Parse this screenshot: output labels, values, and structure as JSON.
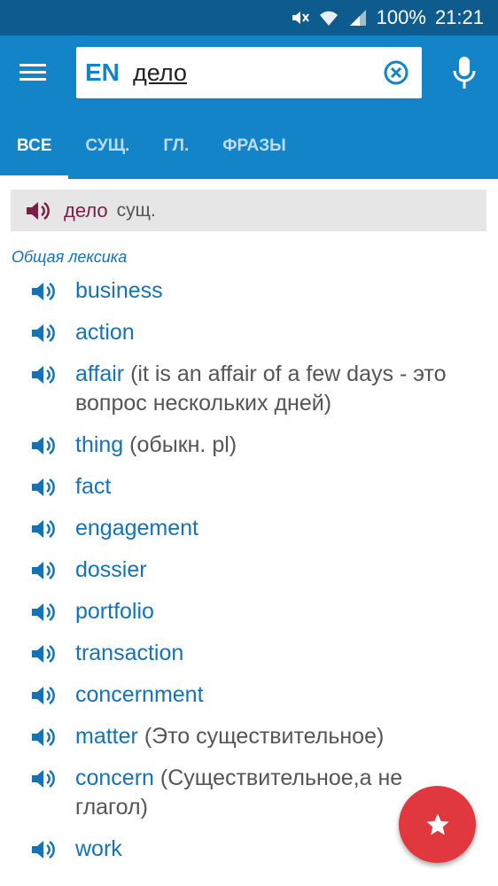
{
  "status_bar": {
    "battery": "100%",
    "time": "21:21"
  },
  "search": {
    "language": "EN",
    "query": "дело"
  },
  "tabs": [
    {
      "label": "ВСЕ",
      "active": true
    },
    {
      "label": "СУЩ.",
      "active": false
    },
    {
      "label": "ГЛ.",
      "active": false
    },
    {
      "label": "ФРАЗЫ",
      "active": false
    }
  ],
  "headword": {
    "word": "дело",
    "pos": "сущ."
  },
  "section": "Общая лексика",
  "entries": [
    {
      "word": "business",
      "note": ""
    },
    {
      "word": "action",
      "note": ""
    },
    {
      "word": "affair",
      "note": "(it is an affair of a few days - это вопрос нескольких дней)"
    },
    {
      "word": "thing",
      "note": "(обыкн. pl)"
    },
    {
      "word": "fact",
      "note": ""
    },
    {
      "word": "engagement",
      "note": ""
    },
    {
      "word": "dossier",
      "note": ""
    },
    {
      "word": "portfolio",
      "note": ""
    },
    {
      "word": "transaction",
      "note": ""
    },
    {
      "word": "concernment",
      "note": ""
    },
    {
      "word": "matter",
      "note": "(Это существительное)"
    },
    {
      "word": "concern",
      "note": "(Существительное,а не глагол)"
    },
    {
      "word": "work",
      "note": ""
    }
  ],
  "colors": {
    "app_bar": "#1384c7",
    "status_bar": "#0e5c8d",
    "link": "#1573b5",
    "headword": "#7a1e48",
    "fab": "#e0383e"
  },
  "icons": [
    "mute-icon",
    "wifi-icon",
    "signal-icon",
    "menu-icon",
    "clear-icon",
    "mic-icon",
    "speaker-icon",
    "star-icon"
  ]
}
